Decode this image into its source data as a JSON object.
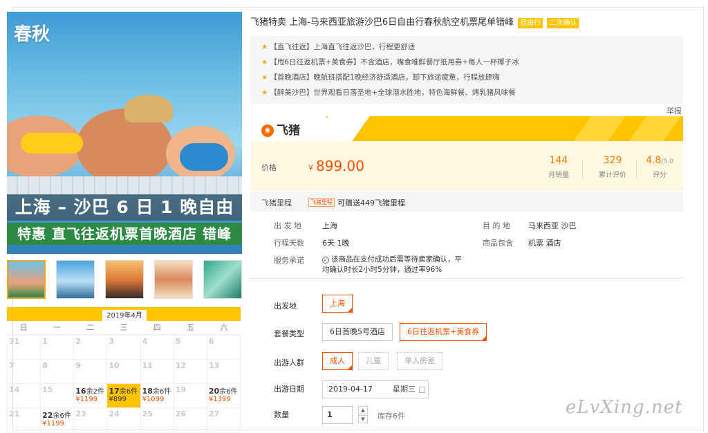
{
  "hero": {
    "logo": "飞猪春秋",
    "logo_short": "春秋",
    "banner_main": "上海 – 沙巴 6 日 1 晚自由行",
    "banner_sub": "特惠 直飞往返机票首晚酒店 错峰"
  },
  "calendar": {
    "month": "2019年4月",
    "weekdays": [
      "日",
      "一",
      "二",
      "三",
      "四",
      "五",
      "六"
    ],
    "rows": [
      [
        {
          "d": "31"
        },
        {
          "d": "1"
        },
        {
          "d": "2"
        },
        {
          "d": "3"
        },
        {
          "d": "4"
        },
        {
          "d": "5"
        },
        {
          "d": "6"
        }
      ],
      [
        {
          "d": "7"
        },
        {
          "d": "8"
        },
        {
          "d": "9"
        },
        {
          "d": "10"
        },
        {
          "d": "11"
        },
        {
          "d": "12"
        },
        {
          "d": "13"
        }
      ],
      [
        {
          "d": "14"
        },
        {
          "d": "15"
        },
        {
          "d": "16",
          "left": "余2件",
          "price": "¥1199"
        },
        {
          "d": "17",
          "left": "余6件",
          "price": "¥899",
          "sel": true
        },
        {
          "d": "18",
          "left": "余6件",
          "price": "¥1099"
        },
        {
          "d": "19"
        },
        {
          "d": "20",
          "left": "余6件",
          "price": "¥1399"
        }
      ],
      [
        {
          "d": "21"
        },
        {
          "d": "22",
          "left": "余6件",
          "price": "¥1199"
        },
        {
          "d": "23"
        },
        {
          "d": "24"
        },
        {
          "d": "25"
        },
        {
          "d": "26"
        },
        {
          "d": "27"
        }
      ]
    ]
  },
  "product": {
    "title": "飞猪特卖 上海-马来西亚旅游沙巴6日自由行春秋航空机票尾单错峰",
    "tags": [
      "自由行",
      "二次确认"
    ],
    "highlights": [
      "【直飞往返】上海直飞往返沙巴，行程更舒适",
      "【甩6日往返机票+美食券】不含酒店，嘴食唯鲜餐厅抵用券+每人一杯椰子冰",
      "【首晚酒店】晚航班搭配1晚经济舒适酒店，卸下旅途疲惫，行程放肆嗨",
      "【醉美沙巴】世界观看日落圣地+全球潜水胜地，特色海鲜餐、烤乳猪风味餐"
    ],
    "report": "举报"
  },
  "brand": {
    "logo_text": "飞猪"
  },
  "price": {
    "label": "价格",
    "currency": "¥",
    "value": "899.00",
    "monthly_sales": "144",
    "monthly_sales_label": "月销量",
    "reviews": "329",
    "reviews_label": "累计评价",
    "rating": "4.8",
    "rating_max": "/5.0",
    "rating_label": "评分"
  },
  "miles": {
    "label": "飞猪里程",
    "badge": "飞猪里程",
    "text": "可赠送449飞猪里程"
  },
  "info": {
    "depart_k": "出 发 地",
    "depart_v": "上海",
    "dest_k": "目 的 地",
    "dest_v": "马来西亚  沙巴",
    "days_k": "行程天数",
    "days_v": "6天  1晚",
    "incl_k": "商品包含",
    "incl_v": "机票  酒店",
    "service_k": "服务承诺",
    "service_v1": "该商品在支付成功后需等待卖家确认，平",
    "service_v2": "均确认时长2小时5分钟，通过率96%"
  },
  "options": {
    "depart_label": "出发地",
    "depart_value": "上海",
    "pkg_label": "套餐类型",
    "pkg_a": "6日首晚5号酒店",
    "pkg_b": "6日往返机票+美食券",
    "people_label": "出游人群",
    "people_a": "成人",
    "people_b": "儿童",
    "people_c": "单人房差",
    "date_label": "出游日期",
    "date_value": "2019-04-17",
    "date_weekday": "星期三",
    "qty_label": "数量",
    "qty_value": "1",
    "stock": "库存6件"
  },
  "watermark": "eLvXing.net"
}
